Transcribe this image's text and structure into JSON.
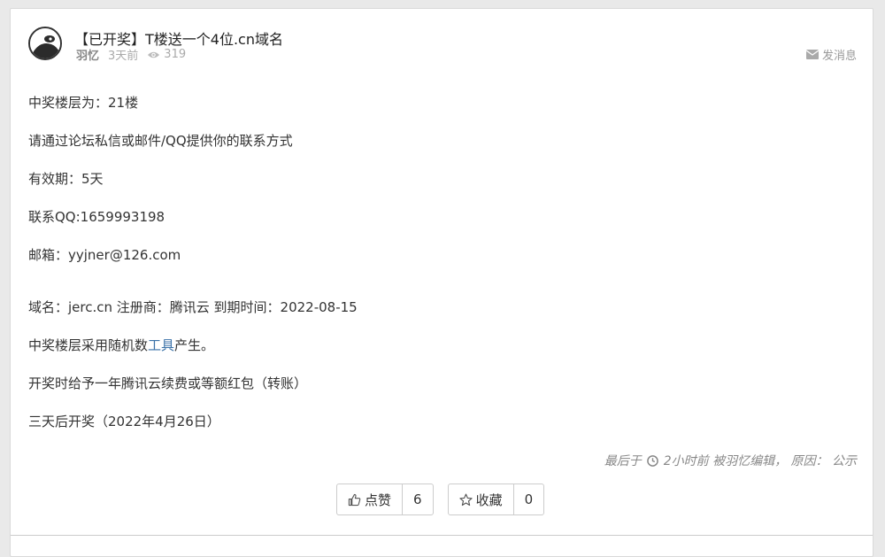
{
  "post": {
    "title": "【已开奖】T楼送一个4位.cn域名",
    "author": "羽忆",
    "time": "3天前",
    "views": "319",
    "message_label": "发消息"
  },
  "content": {
    "line1": "中奖楼层为：21楼",
    "line2": "请通过论坛私信或邮件/QQ提供你的联系方式",
    "line3": "有效期：5天",
    "line4": "联系QQ:1659993198",
    "line5": "邮箱：yyjner@126.com",
    "line6": "域名：jerc.cn 注册商：腾讯云 到期时间：2022-08-15",
    "line7_pre": "中奖楼层采用随机数",
    "line7_link": "工具",
    "line7_post": "产生。",
    "line8": "开奖时给予一年腾讯云续费或等额红包（转账）",
    "line9": "三天后开奖（2022年4月26日）"
  },
  "edit_note": {
    "prefix": "最后于",
    "detail": "2小时前 被羽忆编辑， 原因： 公示"
  },
  "actions": {
    "like_label": "点赞",
    "like_count": "6",
    "fav_label": "收藏",
    "fav_count": "0"
  },
  "icons": {
    "avatar": "avatar-panda",
    "views": "eye-icon",
    "message": "envelope-icon",
    "clock": "clock-icon",
    "like": "thumbs-up-icon",
    "favorite": "star-icon"
  }
}
